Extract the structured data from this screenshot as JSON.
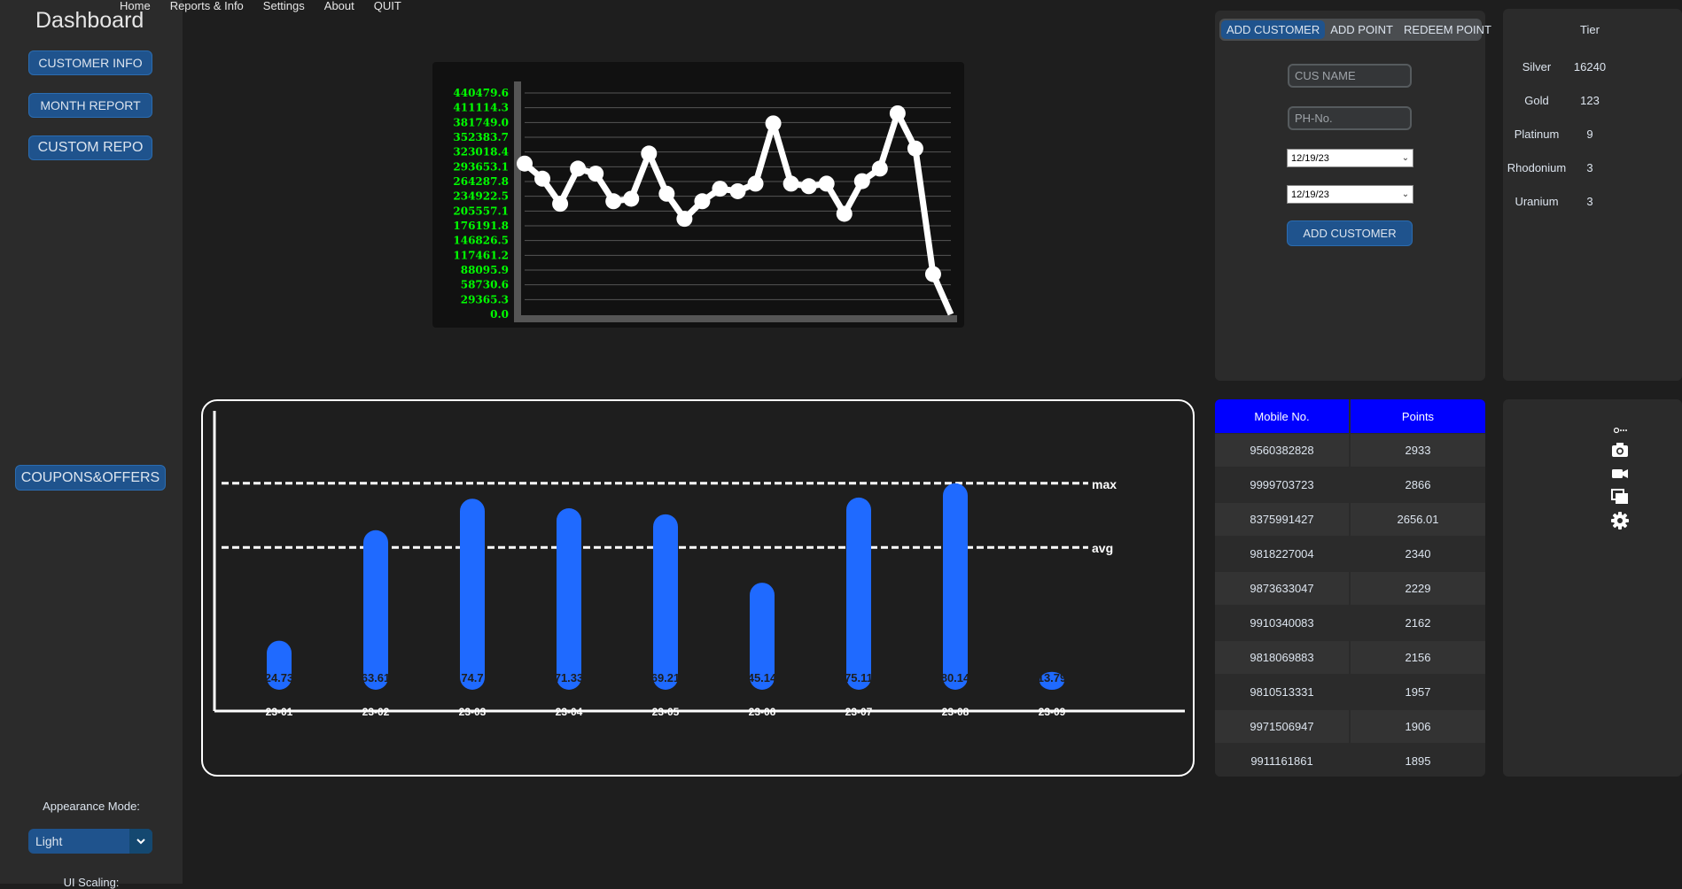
{
  "sidebar": {
    "title": "Dashboard",
    "buttons": [
      "CUSTOMER INFO",
      "MONTH REPORT",
      "CUSTOM REPO"
    ],
    "coupons_button": "COUPONS&OFFERS",
    "appearance_label": "Appearance Mode:",
    "appearance_value": "Light",
    "scaling_label": "UI Scaling:"
  },
  "menu": [
    "Home",
    "Reports & Info",
    "Settings",
    "About",
    "QUIT"
  ],
  "form": {
    "tabs": [
      "ADD CUSTOMER",
      "ADD POINT",
      "REDEEM POINT"
    ],
    "name_placeholder": "CUS NAME",
    "phone_placeholder": "PH-No.",
    "date1": "12/19/23",
    "date2": "12/19/23",
    "submit_label": "ADD CUSTOMER"
  },
  "tiers": {
    "header": "Tier",
    "rows": [
      {
        "name": "Silver",
        "count": "16240"
      },
      {
        "name": "Gold",
        "count": "123"
      },
      {
        "name": "Platinum",
        "count": "9"
      },
      {
        "name": "Rhodonium",
        "count": "3"
      },
      {
        "name": "Uranium",
        "count": "3"
      }
    ]
  },
  "table": {
    "headers": [
      "Mobile No.",
      "Points"
    ],
    "rows": [
      [
        "9560382828",
        "2933"
      ],
      [
        "9999703723",
        "2866"
      ],
      [
        "8375991427",
        "2656.01"
      ],
      [
        "9818227004",
        "2340"
      ],
      [
        "9873633047",
        "2229"
      ],
      [
        "9910340083",
        "2162"
      ],
      [
        "9818069883",
        "2156"
      ],
      [
        "9810513331",
        "1957"
      ],
      [
        "9971506947",
        "1906"
      ],
      [
        "9911161861",
        "1895"
      ]
    ]
  },
  "tool_icons": [
    "camera-icon",
    "video-icon",
    "copy-icon",
    "gear-icon"
  ],
  "colors": {
    "accent": "#1f538d",
    "table_header": "#0000ff",
    "bar": "#1f6aff",
    "line_tick": "#00ff00",
    "line": "#ffffff"
  },
  "chart_data": [
    {
      "type": "line",
      "title": "",
      "ytick_labels": [
        "440479.6",
        "411114.3",
        "381749.0",
        "352383.7",
        "323018.4",
        "293653.1",
        "264287.8",
        "234922.5",
        "205557.1",
        "176191.8",
        "146826.5",
        "117461.2",
        "88095.9",
        "58730.6",
        "29365.3",
        "0.0"
      ],
      "ylim": [
        0,
        440479.6
      ],
      "values": [
        300000,
        270000,
        220000,
        290000,
        280000,
        225000,
        230000,
        320000,
        240000,
        190000,
        225000,
        250000,
        245000,
        260000,
        380000,
        260000,
        255000,
        260000,
        200000,
        265000,
        290000,
        400000,
        330000,
        80000,
        0
      ]
    },
    {
      "type": "bar",
      "categories": [
        "23-01",
        "23-02",
        "23-03",
        "23-04",
        "23-05",
        "23-06",
        "23-07",
        "23-08",
        "23-09"
      ],
      "values": [
        24.73,
        63.61,
        74.7,
        71.33,
        69.21,
        45.14,
        75.11,
        80.14,
        13.79
      ],
      "value_labels": [
        "24.73",
        "63.61",
        "74.7",
        "71.33",
        "69.21",
        "45.14",
        "75.11",
        "80.14",
        "13.79"
      ],
      "ylim": [
        0,
        100
      ],
      "reference_lines": [
        {
          "label": "max",
          "value": 80.14
        },
        {
          "label": "avg",
          "value": 57.56
        }
      ]
    }
  ]
}
